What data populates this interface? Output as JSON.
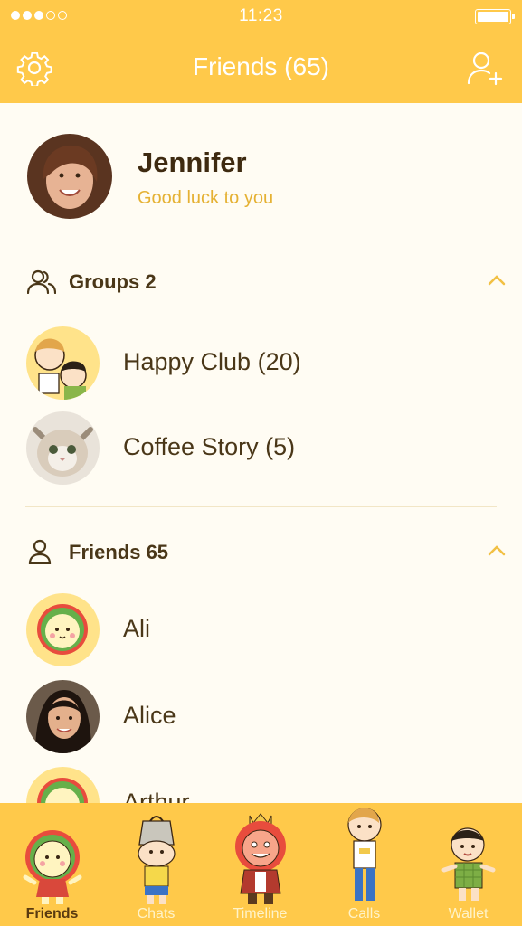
{
  "status": {
    "time": "11:23"
  },
  "header": {
    "title": "Friends (65)"
  },
  "profile": {
    "name": "Jennifer",
    "status": "Good luck to you"
  },
  "groups": {
    "label": "Groups 2",
    "items": [
      {
        "name": "Happy Club (20)"
      },
      {
        "name": "Coffee Story (5)"
      }
    ]
  },
  "friends": {
    "label": "Friends 65",
    "items": [
      {
        "name": "Ali"
      },
      {
        "name": "Alice"
      },
      {
        "name": "Arthur"
      }
    ]
  },
  "tabs": [
    {
      "label": "Friends",
      "active": true
    },
    {
      "label": "Chats"
    },
    {
      "label": "Timeline"
    },
    {
      "label": "Calls"
    },
    {
      "label": "Wallet"
    }
  ],
  "colors": {
    "accent": "#FFC94A",
    "status_text": "#E5B133",
    "text": "#4A3718"
  }
}
